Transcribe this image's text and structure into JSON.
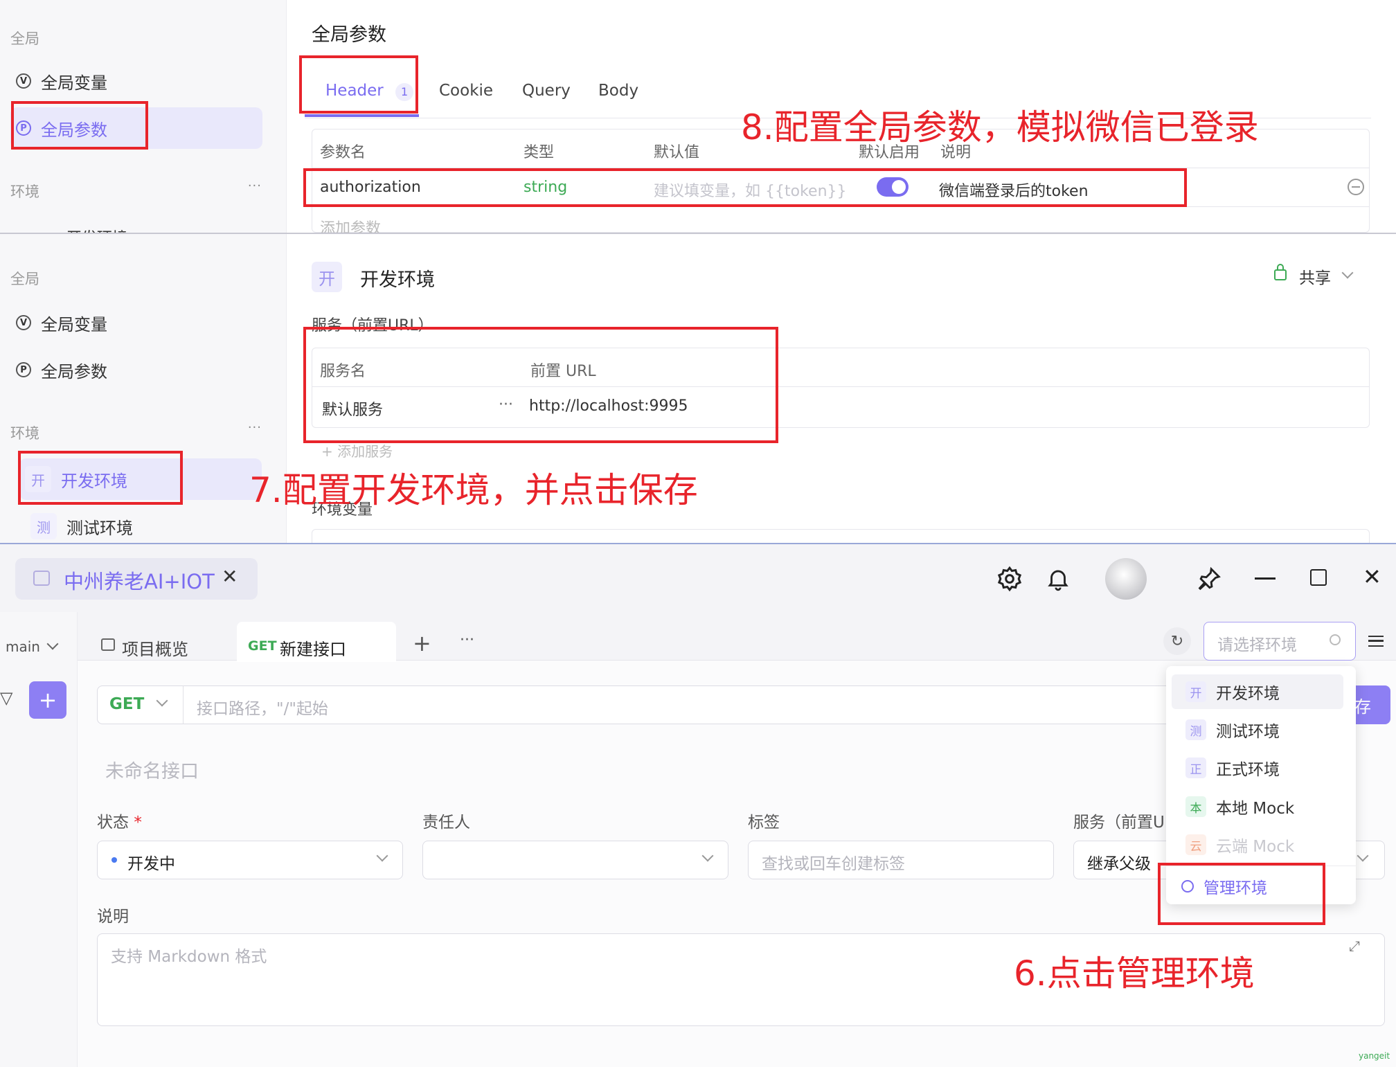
{
  "top": {
    "side": {
      "global_label": "全局",
      "global_vars": "全局变量",
      "global_params": "全局参数",
      "env_label": "环境",
      "env_more": "···",
      "env_peek": "开发环境"
    },
    "title": "全局参数",
    "tabs": {
      "header": "Header",
      "header_count": "1",
      "cookie": "Cookie",
      "query": "Query",
      "body": "Body"
    },
    "columns": {
      "name": "参数名",
      "type": "类型",
      "default": "默认值",
      "enabled": "默认启用",
      "desc": "说明"
    },
    "row": {
      "name": "authorization",
      "type": "string",
      "default_placeholder": "建议填变量，如 {{token}}",
      "enabled": true,
      "desc": "微信端登录后的token"
    },
    "add_param": "添加参数",
    "annotation": "8.配置全局参数，模拟微信已登录"
  },
  "middle": {
    "side": {
      "global_label": "全局",
      "global_vars": "全局变量",
      "global_params": "全局参数",
      "env_label": "环境",
      "env_more": "···",
      "env_dev_badge": "开",
      "env_dev": "开发环境",
      "env_test_badge": "测",
      "env_test": "测试环境"
    },
    "env_badge": "开",
    "env_title": "开发环境",
    "share": "共享",
    "service_section": "服务（前置URL）",
    "columns": {
      "service": "服务名",
      "url": "前置 URL"
    },
    "row": {
      "service": "默认服务",
      "more": "···",
      "url": "http://localhost:9995"
    },
    "add_service": "+ 添加服务",
    "env_vars": "环境变量",
    "annotation": "7.配置开发环境，并点击保存"
  },
  "bottom": {
    "project_tab": "中州养老AI+IOT",
    "branch": "main",
    "tabs": {
      "overview": "项目概览",
      "api_method": "GET",
      "api_title": "新建接口"
    },
    "env_select_placeholder": "请选择环境",
    "method": "GET",
    "path_placeholder": "接口路径，\"/\"起始",
    "save_peek": "存",
    "name_placeholder": "未命名接口",
    "labels": {
      "status": "状态",
      "required_mark": "*",
      "owner": "责任人",
      "tags": "标签",
      "service": "服务（前置U"
    },
    "status_value": "开发中",
    "tags_placeholder": "查找或回车创建标签",
    "service_value": "继承父级",
    "desc_label": "说明",
    "desc_placeholder": "支持 Markdown 格式",
    "env_menu": [
      {
        "badge": "开",
        "label": "开发环境"
      },
      {
        "badge": "测",
        "label": "测试环境"
      },
      {
        "badge": "正",
        "label": "正式环境"
      },
      {
        "badge": "本",
        "label": "本地 Mock"
      },
      {
        "badge": "云",
        "label": "云端 Mock"
      }
    ],
    "manage_env": "管理环境",
    "annotation": "6.点击管理环境",
    "watermark": "yangeit"
  },
  "colors": {
    "accent": "#7a6cf0",
    "red": "#e8242b",
    "green": "#3daa55"
  },
  "icons": [
    "circle-v-icon",
    "circle-p-icon",
    "lock-icon",
    "gear-icon",
    "bell-icon",
    "pin-icon",
    "refresh-icon",
    "search-icon",
    "menu-icon",
    "filter-icon",
    "plus-icon",
    "close-icon"
  ]
}
